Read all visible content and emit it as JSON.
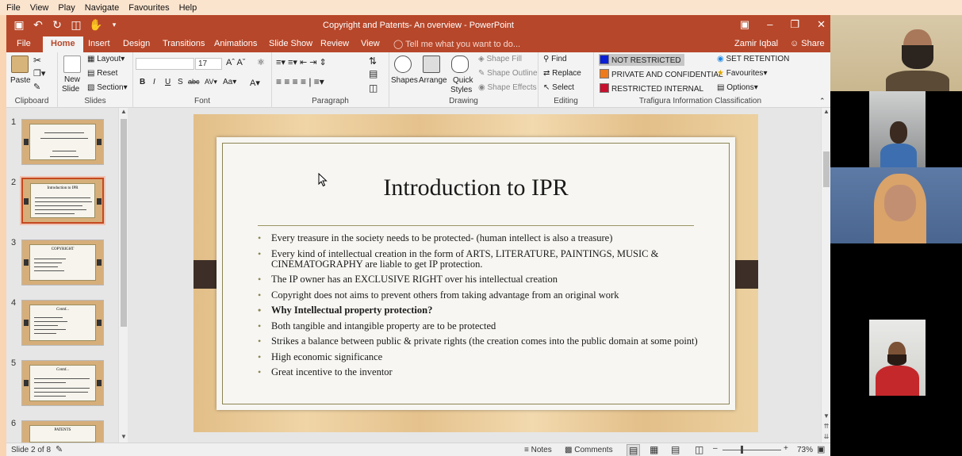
{
  "viewer_menu": [
    "File",
    "View",
    "Play",
    "Navigate",
    "Favourites",
    "Help"
  ],
  "window": {
    "title": "Copyright and Patents- An overview - PowerPoint",
    "user": "Zamir Iqbal",
    "share": "Share"
  },
  "tabs": {
    "file": "File",
    "home": "Home",
    "insert": "Insert",
    "design": "Design",
    "transitions": "Transitions",
    "animations": "Animations",
    "slideshow": "Slide Show",
    "review": "Review",
    "view": "View",
    "tell_me": "Tell me what you want to do..."
  },
  "ribbon": {
    "clipboard": {
      "label": "Clipboard",
      "paste": "Paste"
    },
    "slides": {
      "label": "Slides",
      "new_slide_1": "New",
      "new_slide_2": "Slide",
      "layout": "Layout",
      "reset": "Reset",
      "section": "Section"
    },
    "font": {
      "label": "Font",
      "size": "17"
    },
    "paragraph": {
      "label": "Paragraph"
    },
    "drawing": {
      "label": "Drawing",
      "shapes": "Shapes",
      "arrange": "Arrange",
      "quick_styles_1": "Quick",
      "quick_styles_2": "Styles",
      "shape_fill": "Shape Fill",
      "shape_outline": "Shape Outline",
      "shape_effects": "Shape Effects"
    },
    "editing": {
      "label": "Editing",
      "find": "Find",
      "replace": "Replace",
      "select": "Select"
    },
    "classification": {
      "label": "Trafigura Information Classification",
      "not_restricted": "NOT RESTRICTED",
      "private": "PRIVATE AND CONFIDENTIAL",
      "restricted": "RESTRICTED INTERNAL",
      "set_retention": "SET RETENTION",
      "favourites": "Favourites",
      "options": "Options",
      "colors": {
        "not_restricted": "#0b1fd6",
        "private": "#ee7a1a",
        "restricted": "#c8102e"
      }
    }
  },
  "thumbnails": [
    {
      "num": "1",
      "title": ""
    },
    {
      "num": "2",
      "title": "Introduction to IPR"
    },
    {
      "num": "3",
      "title": "COPYRIGHT"
    },
    {
      "num": "4",
      "title": "Contd..."
    },
    {
      "num": "5",
      "title": "Contd..."
    },
    {
      "num": "6",
      "title": "PATENTS"
    }
  ],
  "slide": {
    "title": "Introduction to IPR",
    "bullets": [
      "Every treasure in the society needs to be protected- (human intellect is also a treasure)",
      "Every kind of intellectual creation in the form of ARTS, LITERATURE, PAINTINGS, MUSIC & CINEMATOGRAPHY are liable to get IP protection.",
      "The IP owner has an EXCLUSIVE RIGHT over his intellectual creation",
      "Copyright does not aims to prevent others from taking advantage from an original work",
      "Why Intellectual property protection?",
      " Both tangible and intangible property are to be protected",
      " Strikes a balance between public & private rights (the creation comes into the public domain at some point)",
      "High economic significance",
      " Great incentive to the inventor"
    ]
  },
  "status": {
    "slide_info": "Slide 2 of 8",
    "notes": "Notes",
    "comments": "Comments",
    "zoom": "73%"
  }
}
